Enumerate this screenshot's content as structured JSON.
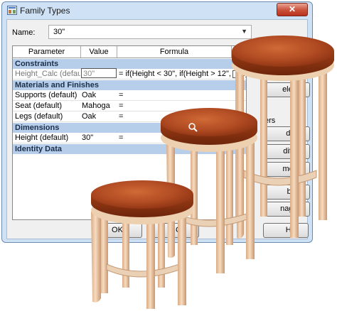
{
  "window": {
    "title": "Family Types",
    "close_symbol": "✕"
  },
  "name_field": {
    "label": "Name:",
    "value": "30\""
  },
  "grid": {
    "columns": [
      "Parameter",
      "Value",
      "Formula"
    ],
    "groups": [
      {
        "title": "Constraints",
        "rows": [
          {
            "parameter": "Height_Calc (default)",
            "value": "30\"",
            "formula": "= if(Height < 30\", if(Height > 12\", Heig"
          }
        ]
      },
      {
        "title": "Materials and Finishes",
        "rows": [
          {
            "parameter": "Supports (default)",
            "value": "Oak",
            "formula": "="
          },
          {
            "parameter": "Seat (default)",
            "value": "Mahoga",
            "formula": "="
          },
          {
            "parameter": "Legs (default)",
            "value": "Oak",
            "formula": "="
          }
        ]
      },
      {
        "title": "Dimensions",
        "rows": [
          {
            "parameter": "Height (default)",
            "value": "30\"",
            "formula": "="
          }
        ]
      },
      {
        "title": "Identity Data",
        "rows": []
      }
    ]
  },
  "side_panel": {
    "delete_button": "elete",
    "params_label": "ers",
    "add_button": "dd...",
    "modify_button": "dify...",
    "remove_button": "move",
    "up_button": "ble",
    "manage_button": "nage..."
  },
  "footer": {
    "ok_button": "OK",
    "cancel_button": "C",
    "help_button": "Hel"
  },
  "colors": {
    "seat_top": "#b04a22",
    "seat_edge": "#8a3212",
    "wood_light": "#f2cfae",
    "wood_shade": "#d7a882",
    "group_band": "#b6ceea"
  },
  "icons": {
    "app": "family-types-icon",
    "zoom": "magnifier-cursor-icon"
  }
}
